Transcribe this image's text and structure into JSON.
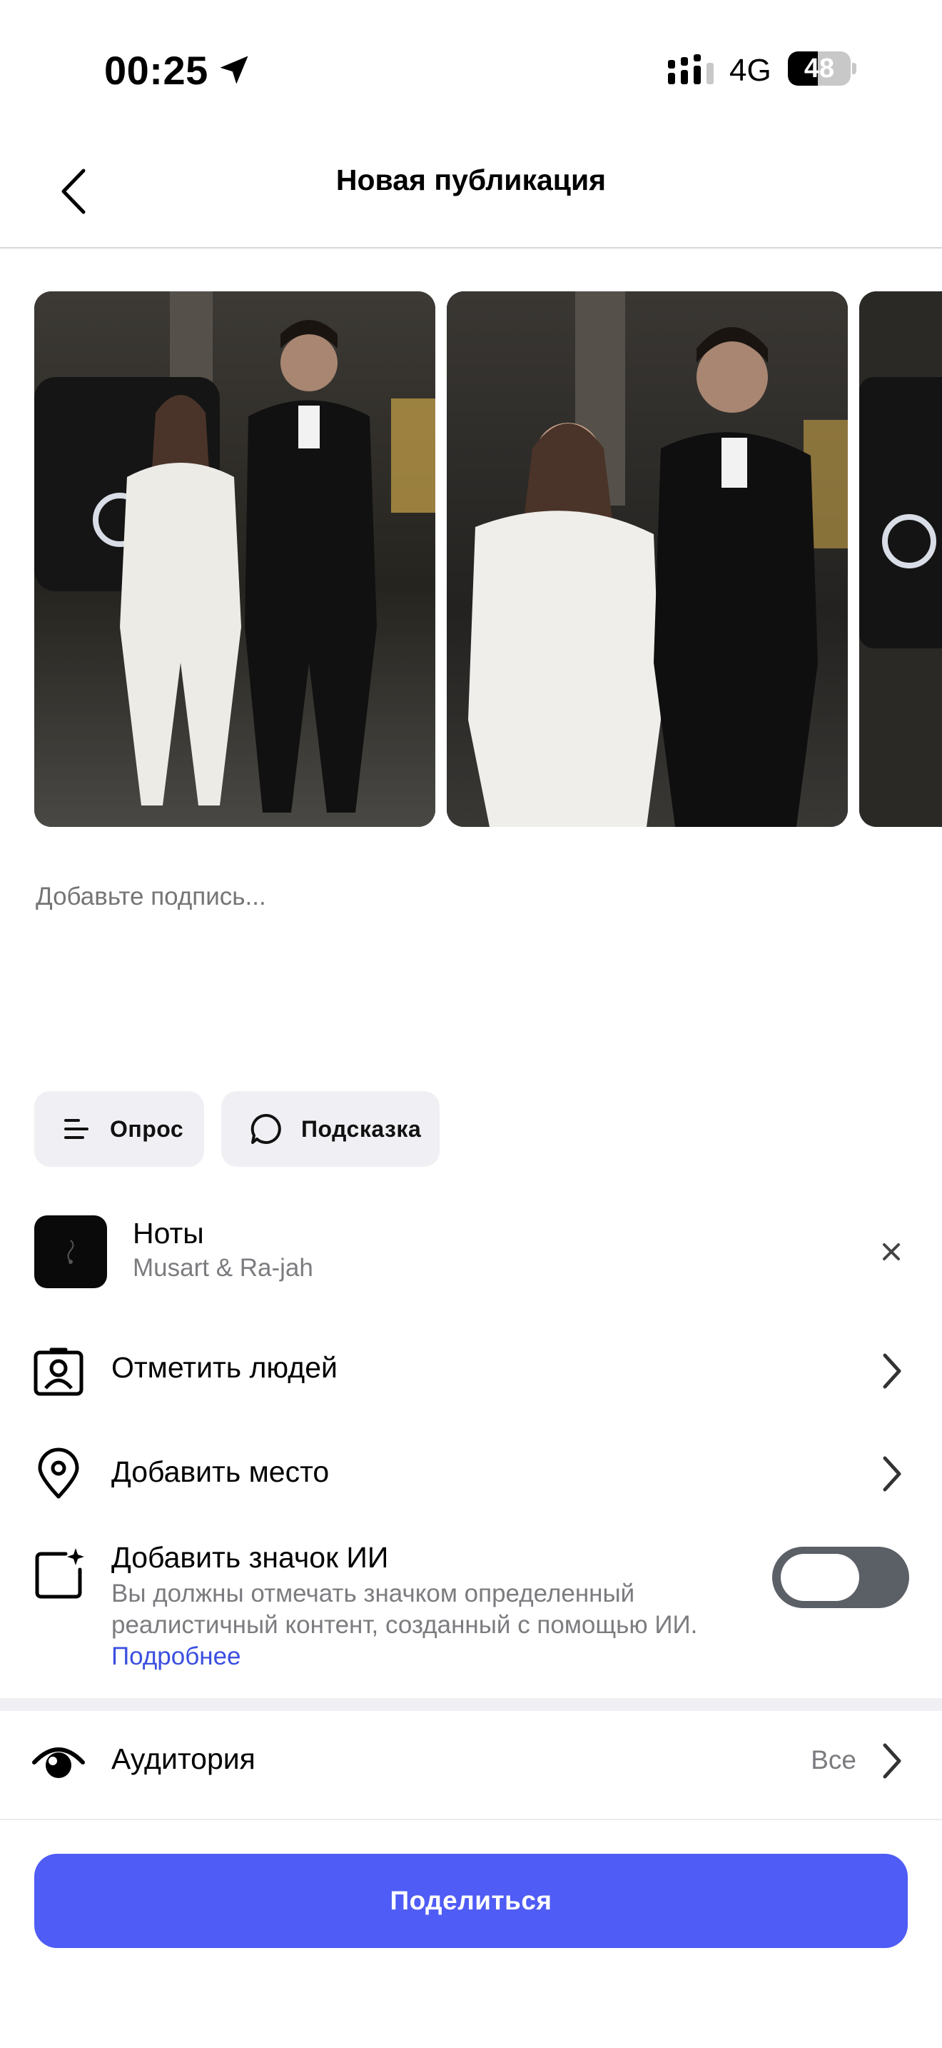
{
  "status_bar": {
    "time": "00:25",
    "network": "4G",
    "battery_level": "48",
    "battery_fraction": 0.48,
    "icons": [
      "location-arrow-icon",
      "signal-bars-icon",
      "battery-icon"
    ]
  },
  "header": {
    "title": "Новая публикация",
    "back_icon": "chevron-left-icon"
  },
  "photos": {
    "count_visible": 3
  },
  "caption": {
    "placeholder": "Добавьте подпись..."
  },
  "chips": {
    "poll": {
      "label": "Опрос",
      "icon": "list-lines-icon"
    },
    "hint": {
      "label": "Подсказка",
      "icon": "speech-bubble-icon"
    }
  },
  "music": {
    "title": "Ноты",
    "artist": "Musart & Ra-jah",
    "close_icon": "close-icon"
  },
  "rows": {
    "tag_people": {
      "label": "Отметить людей",
      "icon": "person-badge-icon"
    },
    "add_location": {
      "label": "Добавить место",
      "icon": "location-pin-icon"
    },
    "ai_label": {
      "label": "Добавить значок ИИ",
      "description": "Вы должны отмечать значком определенный реалистичный контент, созданный с помощью ИИ.",
      "link": "Подробнее",
      "toggle_on": false,
      "icon": "ai-sparkle-square-icon"
    },
    "audience": {
      "label": "Аудитория",
      "value": "Все",
      "icon": "eye-icon"
    }
  },
  "share_button": {
    "label": "Поделиться"
  },
  "colors": {
    "accent": "#4f5cf5",
    "link": "#3b4fe0",
    "secondary_text": "#7c7c80",
    "chip_bg": "#f0f0f4",
    "toggle_off": "#5b5f66"
  }
}
